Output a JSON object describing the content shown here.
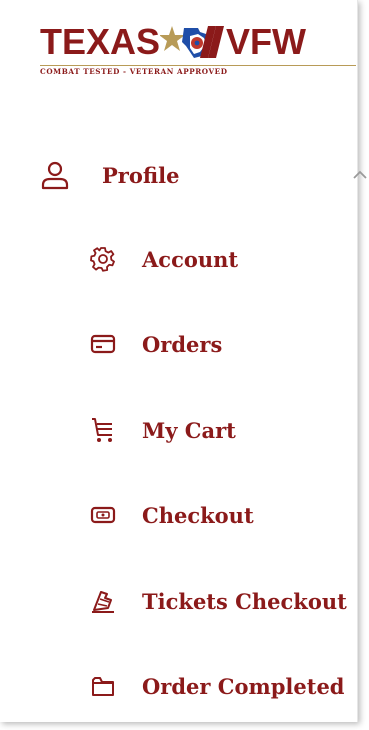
{
  "logo": {
    "left_word": "TEXAS",
    "right_word": "VFW",
    "tagline": "COMBAT TESTED - VETERAN APPROVED",
    "brand_color": "#8b1a1a",
    "accent_color": "#b89b57"
  },
  "nav": {
    "profile": {
      "label": "Profile",
      "icon": "user-icon",
      "expanded": true,
      "chevron": "chevron-up-icon"
    },
    "items": [
      {
        "label": "Account",
        "icon": "gear-icon"
      },
      {
        "label": "Orders",
        "icon": "credit-card-icon"
      },
      {
        "label": "My Cart",
        "icon": "cart-icon"
      },
      {
        "label": "Checkout",
        "icon": "wallet-icon"
      },
      {
        "label": "Tickets Checkout",
        "icon": "ticket-icon"
      },
      {
        "label": "Order Completed",
        "icon": "folder-icon"
      }
    ]
  }
}
